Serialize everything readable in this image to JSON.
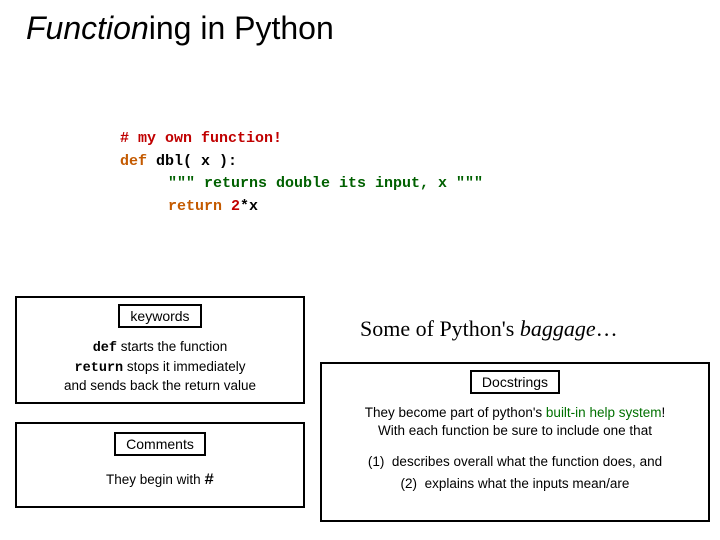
{
  "title": {
    "italic": "Function",
    "rest": "ing in Python"
  },
  "code": {
    "comment": "# my own function!",
    "def": "def",
    "fname": "dbl",
    "params": "( x ):",
    "docstring": "\"\"\" returns double its input, x \"\"\"",
    "ret": "return",
    "expr_num": "2",
    "expr_rest": "*x"
  },
  "keywords": {
    "label": "keywords",
    "def_kw": "def",
    "def_desc": " starts the function",
    "ret_kw": "return",
    "ret_desc": " stops it immediately",
    "line3": "and sends back the return value"
  },
  "comments": {
    "label": "Comments",
    "prefix": "They begin with ",
    "hash": "#"
  },
  "baggage": {
    "prefix": "Some of Python's ",
    "ital": "baggage",
    "suffix": "…"
  },
  "docstrings": {
    "label": "Docstrings",
    "line1_a": "They become part of python's ",
    "line1_b": "built-in help system",
    "line1_c": "!",
    "line2": "With each function be sure to include one that",
    "item1_num": "(1)",
    "item1": "describes overall what the function does, and",
    "item2_num": "(2)",
    "item2": "explains what the inputs mean/are"
  }
}
